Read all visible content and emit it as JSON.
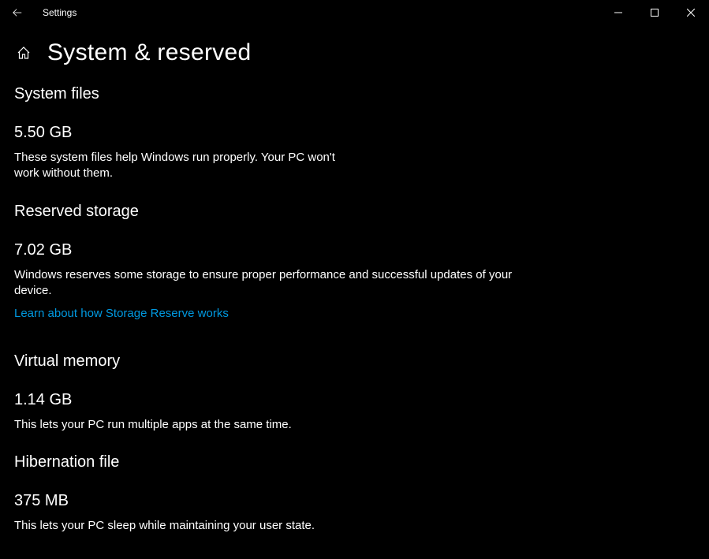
{
  "titlebar": {
    "title": "Settings"
  },
  "page": {
    "title": "System & reserved"
  },
  "sections": {
    "system_files": {
      "title": "System files",
      "value": "5.50 GB",
      "desc": "These system files help Windows run properly. Your PC won't work without them."
    },
    "reserved_storage": {
      "title": "Reserved storage",
      "value": "7.02 GB",
      "desc": "Windows reserves some storage to ensure proper performance and successful updates of your device.",
      "link": "Learn about how Storage Reserve works"
    },
    "virtual_memory": {
      "title": "Virtual memory",
      "value": "1.14 GB",
      "desc": "This lets your PC run multiple apps at the same time."
    },
    "hibernation_file": {
      "title": "Hibernation file",
      "value": "375 MB",
      "desc": "This lets your PC sleep while maintaining your user state."
    }
  }
}
